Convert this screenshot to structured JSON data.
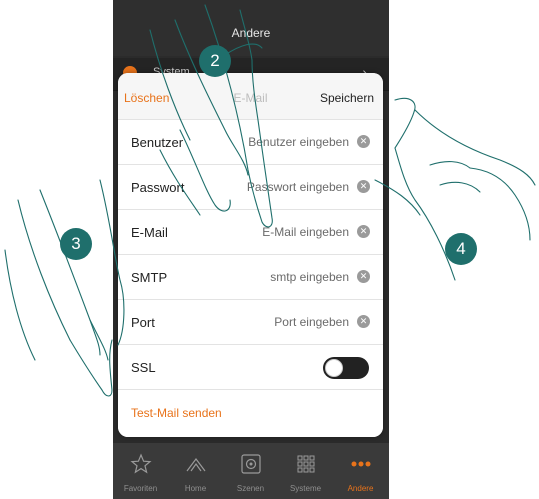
{
  "app": {
    "header_title": "Andere",
    "background_row_label": "System"
  },
  "dialog": {
    "delete_label": "Löschen",
    "title": "E-Mail",
    "save_label": "Speichern",
    "fields": [
      {
        "label": "Benutzer",
        "placeholder": "Benutzer eingeben"
      },
      {
        "label": "Passwort",
        "placeholder": "Passwort eingeben"
      },
      {
        "label": "E-Mail",
        "placeholder": "E-Mail eingeben"
      },
      {
        "label": "SMTP",
        "placeholder": "smtp eingeben"
      },
      {
        "label": "Port",
        "placeholder": "Port eingeben"
      }
    ],
    "ssl_label": "SSL",
    "ssl_enabled": false,
    "test_mail_label": "Test-Mail senden"
  },
  "tabbar": {
    "items": [
      {
        "label": "Favoriten",
        "icon": "star-icon"
      },
      {
        "label": "Home",
        "icon": "house-icon"
      },
      {
        "label": "Szenen",
        "icon": "scene-icon"
      },
      {
        "label": "Systeme",
        "icon": "grid-icon"
      },
      {
        "label": "Andere",
        "icon": "more-icon"
      }
    ],
    "active": "Andere"
  },
  "steps": {
    "step2": "2",
    "step3": "3",
    "step4": "4"
  },
  "colors": {
    "accent": "#e8731b",
    "step_badge": "#1f6f6c"
  }
}
